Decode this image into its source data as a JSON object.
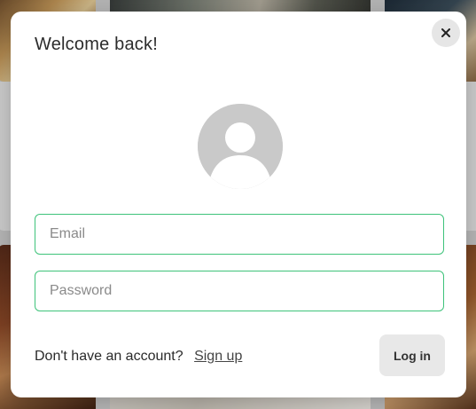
{
  "modal": {
    "title": "Welcome back!",
    "close_icon": "close-icon",
    "avatar_icon": "default-user-avatar-icon",
    "email": {
      "placeholder": "Email",
      "value": ""
    },
    "password": {
      "placeholder": "Password",
      "value": ""
    },
    "signup_prompt": "Don't have an account?",
    "signup_link": "Sign up",
    "login_label": "Log in"
  },
  "colors": {
    "field_border": "#3ec37a",
    "modal_background": "#ffffff",
    "button_background": "#e8e8e8",
    "avatar_gray": "#c9c9c9"
  }
}
